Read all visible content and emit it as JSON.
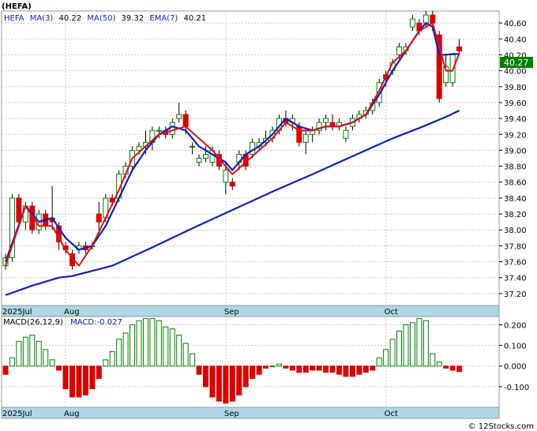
{
  "title": "(HEFA)",
  "watermark": "© 12Stocks.com",
  "legend": {
    "symbol": "HEFA",
    "ma3_label": "MA(3)",
    "ma3_value": "40.22",
    "ma50_label": "MA(50)",
    "ma50_value": "39.32",
    "ema7_label": "EMA(7)",
    "ema7_value": "40.21"
  },
  "macd_legend": {
    "params": "MACD(26,12,9)",
    "value": "MACD:-0.027"
  },
  "last_price_label": "40.27",
  "colors": {
    "up": "#008000",
    "down": "#dd0000",
    "ma_blue": "#1020c0",
    "ema_red": "#e01010",
    "axis_strip": "#add8e6",
    "grid": "#c8c8c8",
    "price_box": "#008000"
  },
  "chart_data": [
    {
      "type": "candlestick",
      "symbol": "HEFA",
      "x_labels": [
        "2025Jul",
        "Aug",
        "Sep",
        "Oct"
      ],
      "y_ticks": [
        "37.20",
        "37.40",
        "37.60",
        "37.80",
        "38.00",
        "38.20",
        "38.40",
        "38.60",
        "38.80",
        "39.00",
        "39.20",
        "39.40",
        "39.60",
        "39.80",
        "40.00",
        "40.20",
        "40.40",
        "40.60"
      ],
      "ylim": [
        37.05,
        40.75
      ],
      "grid": true,
      "candles": [
        [
          37.55,
          37.7,
          37.5,
          37.65
        ],
        [
          37.65,
          38.45,
          37.6,
          38.4
        ],
        [
          38.4,
          38.45,
          38.05,
          38.1
        ],
        [
          38.1,
          38.35,
          38.0,
          38.3
        ],
        [
          38.3,
          38.35,
          37.95,
          38.0
        ],
        [
          38.0,
          38.25,
          37.95,
          38.2
        ],
        [
          38.2,
          38.25,
          38.0,
          38.05
        ],
        [
          38.15,
          38.55,
          38.0,
          38.1
        ],
        [
          38.05,
          38.1,
          37.75,
          37.85
        ],
        [
          37.8,
          37.85,
          37.7,
          37.75
        ],
        [
          37.7,
          37.75,
          37.5,
          37.55
        ],
        [
          37.75,
          37.85,
          37.7,
          37.8
        ],
        [
          37.8,
          37.85,
          37.7,
          37.75
        ],
        [
          37.8,
          37.85,
          37.75,
          37.8
        ],
        [
          38.2,
          38.35,
          37.95,
          38.1
        ],
        [
          38.15,
          38.45,
          38.1,
          38.4
        ],
        [
          38.4,
          38.45,
          38.3,
          38.35
        ],
        [
          38.4,
          38.75,
          38.35,
          38.7
        ],
        [
          38.7,
          38.85,
          38.65,
          38.8
        ],
        [
          38.8,
          39.05,
          38.75,
          39.0
        ],
        [
          39.0,
          39.1,
          38.95,
          39.05
        ],
        [
          39.05,
          39.25,
          38.95,
          39.1
        ],
        [
          39.1,
          39.3,
          39.0,
          39.25
        ],
        [
          39.25,
          39.3,
          39.15,
          39.25
        ],
        [
          39.25,
          39.3,
          39.15,
          39.2
        ],
        [
          39.2,
          39.4,
          39.15,
          39.35
        ],
        [
          39.4,
          39.6,
          39.35,
          39.45
        ],
        [
          39.45,
          39.5,
          39.2,
          39.3
        ],
        [
          39.05,
          39.1,
          38.95,
          39.05
        ],
        [
          38.85,
          38.95,
          38.8,
          38.9
        ],
        [
          38.9,
          39.05,
          38.85,
          38.95
        ],
        [
          38.85,
          39.05,
          38.8,
          39.0
        ],
        [
          38.95,
          39.0,
          38.75,
          38.8
        ],
        [
          38.6,
          38.85,
          38.45,
          38.75
        ],
        [
          38.6,
          38.65,
          38.5,
          38.55
        ],
        [
          38.85,
          39.0,
          38.75,
          38.95
        ],
        [
          38.95,
          39.0,
          38.75,
          38.8
        ],
        [
          38.95,
          39.15,
          38.9,
          39.1
        ],
        [
          39.05,
          39.15,
          39.0,
          39.1
        ],
        [
          39.1,
          39.25,
          39.05,
          39.15
        ],
        [
          39.15,
          39.3,
          39.1,
          39.25
        ],
        [
          39.25,
          39.45,
          39.2,
          39.4
        ],
        [
          39.4,
          39.5,
          39.3,
          39.35
        ],
        [
          39.35,
          39.45,
          39.25,
          39.4
        ],
        [
          39.3,
          39.35,
          39.05,
          39.1
        ],
        [
          39.1,
          39.25,
          38.95,
          39.2
        ],
        [
          39.2,
          39.3,
          39.1,
          39.25
        ],
        [
          39.25,
          39.4,
          39.2,
          39.35
        ],
        [
          39.35,
          39.45,
          39.25,
          39.4
        ],
        [
          39.35,
          39.45,
          39.25,
          39.3
        ],
        [
          39.3,
          39.4,
          39.25,
          39.35
        ],
        [
          39.15,
          39.3,
          39.1,
          39.25
        ],
        [
          39.3,
          39.45,
          39.25,
          39.4
        ],
        [
          39.4,
          39.5,
          39.35,
          39.45
        ],
        [
          39.45,
          39.55,
          39.4,
          39.5
        ],
        [
          39.5,
          39.65,
          39.45,
          39.6
        ],
        [
          39.6,
          39.9,
          39.55,
          39.85
        ],
        [
          39.95,
          40.0,
          39.8,
          39.9
        ],
        [
          40.0,
          40.15,
          39.95,
          40.1
        ],
        [
          40.2,
          40.35,
          40.15,
          40.3
        ],
        [
          40.25,
          40.35,
          40.2,
          40.3
        ],
        [
          40.55,
          40.7,
          40.5,
          40.65
        ],
        [
          40.6,
          40.65,
          40.45,
          40.5
        ],
        [
          40.6,
          40.75,
          40.55,
          40.7
        ],
        [
          40.7,
          40.75,
          40.5,
          40.6
        ],
        [
          40.45,
          40.5,
          39.6,
          39.65
        ],
        [
          39.85,
          40.2,
          39.8,
          40.05
        ],
        [
          39.85,
          40.2,
          39.8,
          40.2
        ],
        [
          40.3,
          40.4,
          40.2,
          40.25
        ]
      ],
      "ma3": [
        [
          0,
          37.55
        ],
        [
          3,
          38.3
        ],
        [
          5,
          38.05
        ],
        [
          7,
          38.05
        ],
        [
          9,
          37.75
        ],
        [
          11,
          37.55
        ],
        [
          13,
          37.8
        ],
        [
          15,
          38.15
        ],
        [
          17,
          38.5
        ],
        [
          19,
          38.9
        ],
        [
          21,
          39.05
        ],
        [
          23,
          39.2
        ],
        [
          25,
          39.25
        ],
        [
          27,
          39.3
        ],
        [
          29,
          39.15
        ],
        [
          31,
          39.0
        ],
        [
          33,
          38.8
        ],
        [
          34,
          38.7
        ],
        [
          36,
          38.85
        ],
        [
          38,
          39.0
        ],
        [
          40,
          39.15
        ],
        [
          42,
          39.35
        ],
        [
          44,
          39.25
        ],
        [
          46,
          39.25
        ],
        [
          48,
          39.3
        ],
        [
          50,
          39.3
        ],
        [
          52,
          39.35
        ],
        [
          54,
          39.45
        ],
        [
          56,
          39.75
        ],
        [
          58,
          40.1
        ],
        [
          60,
          40.25
        ],
        [
          62,
          40.5
        ],
        [
          64,
          40.6
        ],
        [
          65,
          40.3
        ],
        [
          66,
          40.0
        ],
        [
          67,
          40.0
        ],
        [
          68,
          40.22
        ]
      ],
      "ma50": [
        [
          0,
          37.18
        ],
        [
          4,
          37.3
        ],
        [
          8,
          37.4
        ],
        [
          10,
          37.42
        ],
        [
          16,
          37.55
        ],
        [
          22,
          37.78
        ],
        [
          28,
          38.02
        ],
        [
          34,
          38.25
        ],
        [
          40,
          38.48
        ],
        [
          46,
          38.7
        ],
        [
          50,
          38.85
        ],
        [
          54,
          39.0
        ],
        [
          58,
          39.15
        ],
        [
          62,
          39.28
        ],
        [
          66,
          39.42
        ],
        [
          68,
          39.5
        ]
      ],
      "ema7": [
        [
          0,
          37.6
        ],
        [
          3,
          38.3
        ],
        [
          5,
          38.1
        ],
        [
          7,
          38.15
        ],
        [
          9,
          37.9
        ],
        [
          11,
          37.75
        ],
        [
          13,
          37.8
        ],
        [
          15,
          38.05
        ],
        [
          17,
          38.4
        ],
        [
          19,
          38.75
        ],
        [
          21,
          39.0
        ],
        [
          23,
          39.2
        ],
        [
          25,
          39.3
        ],
        [
          27,
          39.25
        ],
        [
          29,
          39.05
        ],
        [
          31,
          38.95
        ],
        [
          33,
          38.85
        ],
        [
          34,
          38.75
        ],
        [
          36,
          38.95
        ],
        [
          38,
          39.05
        ],
        [
          40,
          39.2
        ],
        [
          42,
          39.4
        ],
        [
          44,
          39.3
        ],
        [
          46,
          39.25
        ],
        [
          48,
          39.3
        ],
        [
          50,
          39.3
        ],
        [
          52,
          39.35
        ],
        [
          54,
          39.45
        ],
        [
          56,
          39.7
        ],
        [
          58,
          40.0
        ],
        [
          60,
          40.25
        ],
        [
          62,
          40.5
        ],
        [
          63,
          40.6
        ],
        [
          64,
          40.55
        ],
        [
          65,
          40.2
        ],
        [
          66,
          40.2
        ],
        [
          67,
          40.21
        ],
        [
          68,
          40.21
        ]
      ]
    },
    {
      "type": "bar",
      "title": "MACD(26,12,9)",
      "y_ticks": [
        "0.200",
        "0.100",
        "0.000",
        "-0.100"
      ],
      "ylim": [
        -0.2,
        0.24
      ],
      "values": [
        -0.04,
        0.04,
        0.12,
        0.14,
        0.15,
        0.12,
        0.08,
        0.03,
        -0.02,
        -0.11,
        -0.15,
        -0.15,
        -0.14,
        -0.11,
        -0.06,
        0.03,
        0.07,
        0.13,
        0.16,
        0.2,
        0.22,
        0.23,
        0.23,
        0.22,
        0.19,
        0.18,
        0.15,
        0.11,
        0.06,
        -0.04,
        -0.1,
        -0.15,
        -0.17,
        -0.18,
        -0.17,
        -0.14,
        -0.1,
        -0.06,
        -0.04,
        -0.01,
        0.0,
        0.01,
        -0.01,
        -0.02,
        -0.03,
        -0.03,
        -0.02,
        -0.02,
        -0.03,
        -0.03,
        -0.04,
        -0.05,
        -0.05,
        -0.04,
        -0.03,
        -0.02,
        0.04,
        0.08,
        0.13,
        0.17,
        0.2,
        0.21,
        0.23,
        0.22,
        0.06,
        0.02,
        -0.01,
        -0.02,
        -0.027
      ]
    }
  ]
}
